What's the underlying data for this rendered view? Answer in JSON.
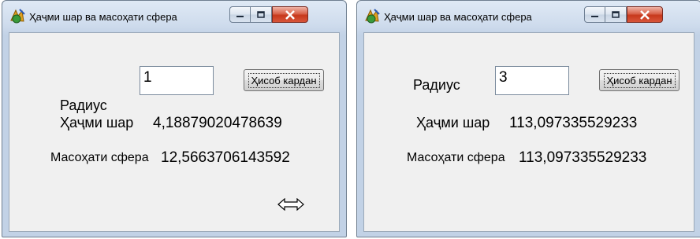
{
  "windows": [
    {
      "title": "Ҳаҷми шар ва масоҳати сфера",
      "radius_label": "Радиус",
      "radius_value": "1",
      "compute_button": "Ҳисоб кардан",
      "volume_label": "Ҳаҷми шар",
      "volume_value": "4,18879020478639",
      "area_label": "Масоҳати сфера",
      "area_value": "12,5663706143592",
      "cursor_icon": "horizontal-resize-cursor-icon"
    },
    {
      "title": "Ҳаҷми шар ва масоҳати сфера",
      "radius_label": "Радиус",
      "radius_value": "3",
      "compute_button": "Ҳисоб кардан",
      "volume_label": "Ҳаҷми шар",
      "volume_value": "113,097335529233",
      "area_label": "Масоҳати сфера",
      "area_value": "113,097335529233"
    }
  ],
  "colors": {
    "title_bar": "#cfdced",
    "client_background": "#f0f0f0",
    "close_button": "#c7381c"
  }
}
